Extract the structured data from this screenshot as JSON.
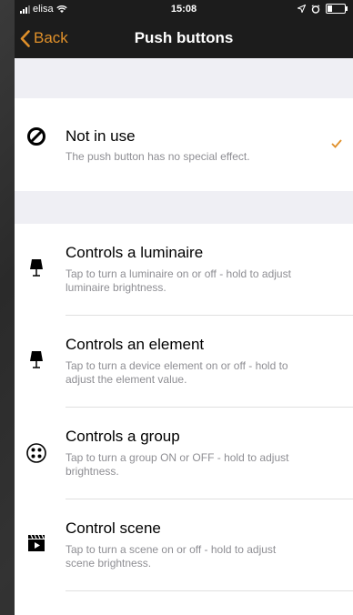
{
  "status_bar": {
    "carrier": "elisa",
    "time": "15:08"
  },
  "nav": {
    "back_label": "Back",
    "title": "Push buttons"
  },
  "options": [
    {
      "title": "Not in use",
      "subtitle": "The push button has no special effect.",
      "icon": "no-entry-icon",
      "selected": true
    },
    {
      "title": "Controls a luminaire",
      "subtitle": "Tap to turn a luminaire on or off - hold to adjust luminaire brightness.",
      "icon": "lamp-icon",
      "selected": false
    },
    {
      "title": "Controls an element",
      "subtitle": "Tap to turn a device element on or off - hold to adjust the element value.",
      "icon": "lamp-icon",
      "selected": false
    },
    {
      "title": "Controls a group",
      "subtitle": "Tap to turn a group ON or OFF - hold to adjust brightness.",
      "icon": "group-icon",
      "selected": false
    },
    {
      "title": "Control scene",
      "subtitle": "Tap to turn a scene on or off - hold to adjust scene brightness.",
      "icon": "scene-clapper-icon",
      "selected": false
    }
  ],
  "colors": {
    "accent": "#e0902a",
    "bar": "#1c1c1c",
    "group_bg": "#efeff4"
  }
}
